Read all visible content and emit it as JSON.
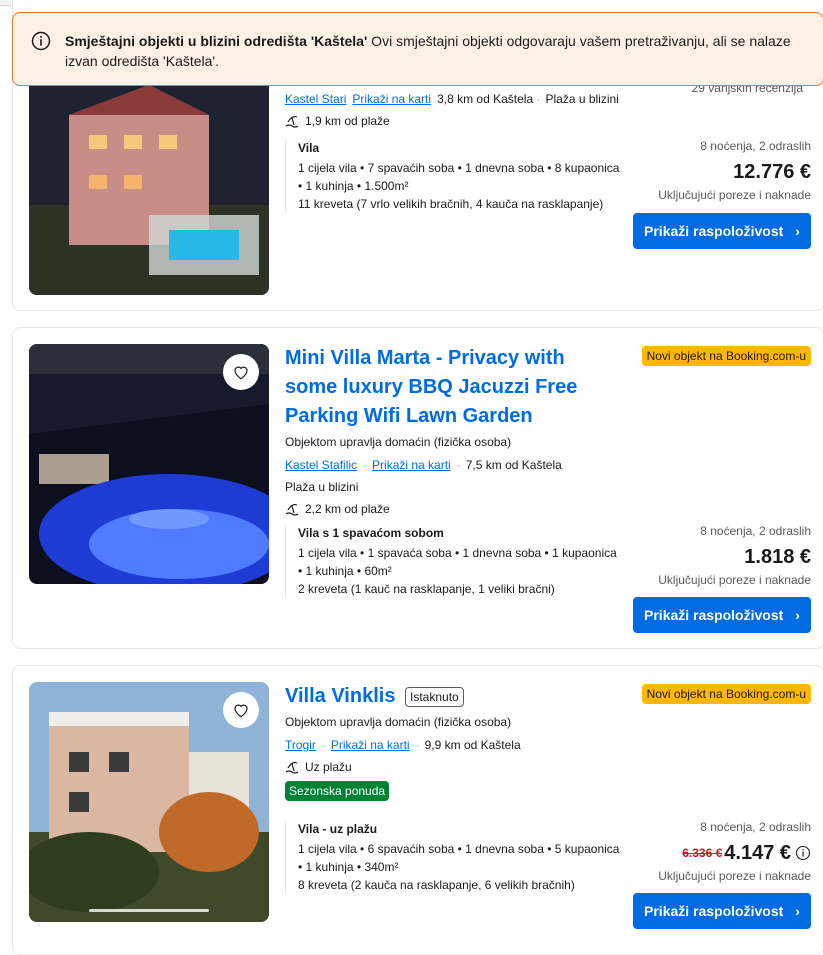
{
  "notice": {
    "bold": "Smještajni objekti u blizini odredišta 'Kaštela'",
    "text": " Ovi smještajni objekti odgovaraju vašem pretraživanju, ali se nalaze izvan odredišta 'Kaštela'."
  },
  "listings": [
    {
      "reviews": "29 vanjskih recenzija",
      "location_link": "Kastel Stari",
      "map_link": "Prikaži na karti",
      "distance": "3,8 km od Kaštela",
      "beach_nearby": "Plaža u blizini",
      "beach_distance": "1,9 km od plaže",
      "unit_name": "Vila",
      "unit_line1": "1 cijela vila • 7 spavaćih soba • 1 dnevna soba • 8 kupaonica",
      "unit_line2": "• 1 kuhinja • 1.500m²",
      "unit_line3": "11 kreveta (7 vrlo velikih bračnih, 4 kauča na rasklapanje)",
      "nights": "8 noćenja, 2 odraslih",
      "price": "12.776 €",
      "tax": "Uključujući poreze i naknade",
      "button": "Prikaži raspoloživost"
    },
    {
      "title": "Mini Villa Marta - Privacy with some luxury BBQ Jacuzzi Free Parking Wifi Lawn Garden",
      "badge": "Novi objekt na Booking.com-u",
      "managed": "Objektom upravlja domaćin (fizička osoba)",
      "location_link": "Kastel Stafilic",
      "map_link": "Prikaži na karti",
      "distance": "7,5 km od Kaštela",
      "beach_nearby": "Plaža u blizini",
      "beach_distance": "2,2 km od plaže",
      "unit_name": "Vila s 1 spavaćom sobom",
      "unit_line1": "1 cijela vila • 1 spavaća soba • 1 dnevna soba • 1 kupaonica",
      "unit_line2": "• 1 kuhinja • 60m²",
      "unit_line3": "2 kreveta (1 kauč na rasklapanje, 1 veliki bračni)",
      "nights": "8 noćenja, 2 odraslih",
      "price": "1.818 €",
      "tax": "Uključujući poreze i naknade",
      "button": "Prikaži raspoloživost"
    },
    {
      "title": "Villa Vinklis",
      "preferred": "Istaknuto",
      "badge": "Novi objekt na Booking.com-u",
      "managed": "Objektom upravlja domaćin (fizička osoba)",
      "location_link": "Trogir",
      "map_link": "Prikaži na karti",
      "distance": "9,9 km od Kaštela",
      "beach_distance": "Uz plažu",
      "deal": "Sezonska ponuda",
      "unit_name": "Vila - uz plažu",
      "unit_line1": "1 cijela vila • 6 spavaćih soba • 1 dnevna soba • 5 kupaonica",
      "unit_line2": "• 1 kuhinja • 340m²",
      "unit_line3": "8 kreveta (2 kauča na rasklapanje, 6 velikih bračnih)",
      "nights": "8 noćenja, 2 odraslih",
      "old_price": "6.336 €",
      "price": "4.147 €",
      "tax": "Uključujući poreze i naknade",
      "button": "Prikaži raspoloživost"
    }
  ],
  "colors": {
    "brand_blue": "#006ce4",
    "badge_yellow": "#ffb700",
    "deal_green": "#008234",
    "notice_border": "#e97a2c"
  }
}
